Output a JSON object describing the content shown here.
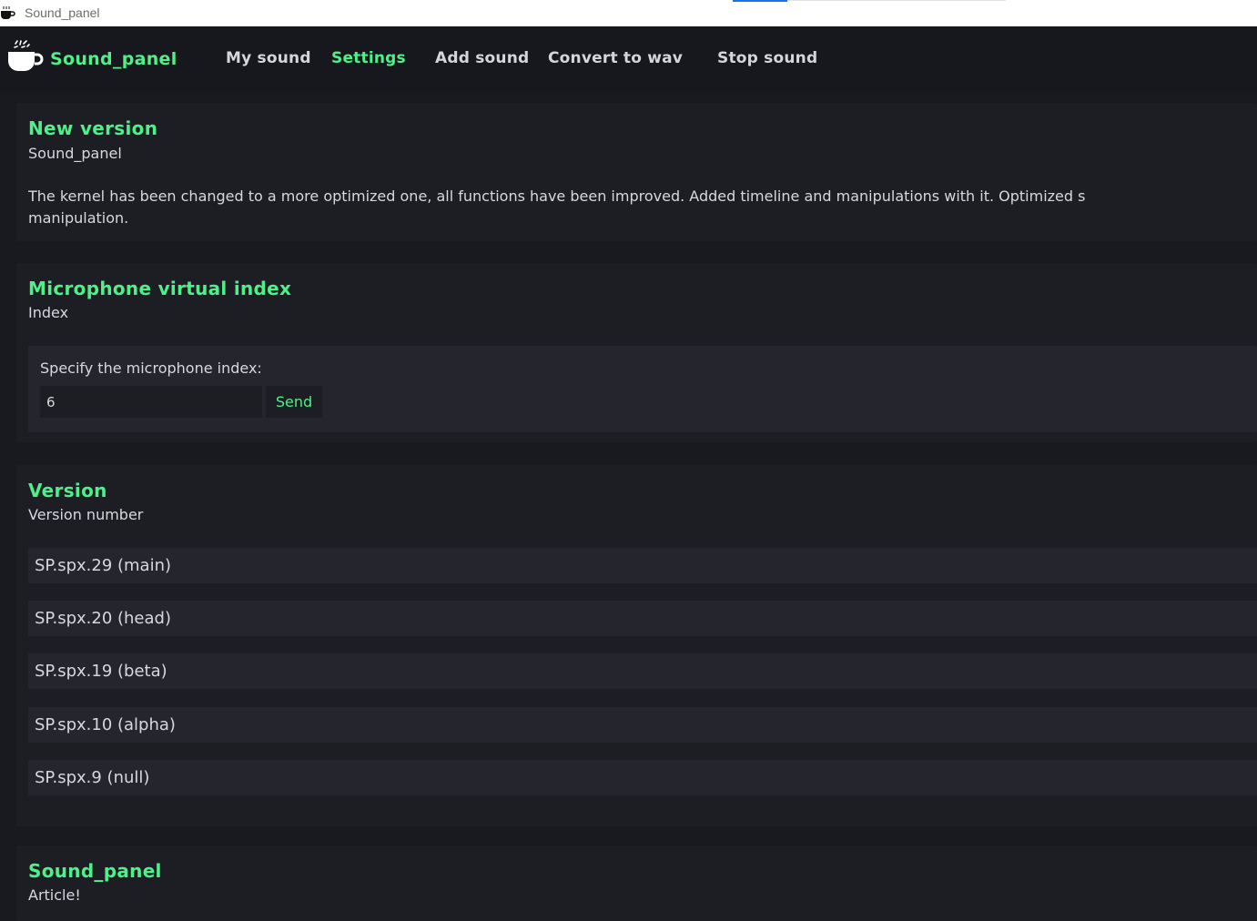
{
  "window": {
    "title": "Sound_panel",
    "icon": "coffee-cup-icon"
  },
  "nav": {
    "brand": "Sound_panel",
    "brand_icon": "coffee-cup-icon",
    "items": [
      {
        "label": "My sound",
        "active": false
      },
      {
        "label": "Settings",
        "active": true
      },
      {
        "label": "Add sound",
        "active": false
      },
      {
        "label": "Convert to wav",
        "active": false
      },
      {
        "label": "Stop sound",
        "active": false
      }
    ]
  },
  "news": {
    "title": "New version",
    "subtitle": "Sound_panel",
    "body_line1": "The kernel has been changed to a more optimized one, all functions have been improved. Added timeline and manipulations with it. Optimized s",
    "body_line2": "manipulation."
  },
  "microphone": {
    "title": "Microphone virtual index",
    "subtitle": "Index",
    "field_label": "Specify the microphone index:",
    "input_value": "6",
    "send_label": "Send"
  },
  "version": {
    "title": "Version",
    "subtitle": "Version number",
    "rows": [
      "SP.spx.29 (main)",
      "SP.spx.20 (head)",
      "SP.spx.19 (beta)",
      "SP.spx.10 (alpha)",
      "SP.spx.9 (null)"
    ]
  },
  "article": {
    "title": "Sound_panel",
    "subtitle": "Article!"
  },
  "colors": {
    "background": "#191a1f",
    "panel": "#1d1e24",
    "inner": "#25262d",
    "accent": "#4ef08a",
    "text": "#d8d8dc"
  }
}
